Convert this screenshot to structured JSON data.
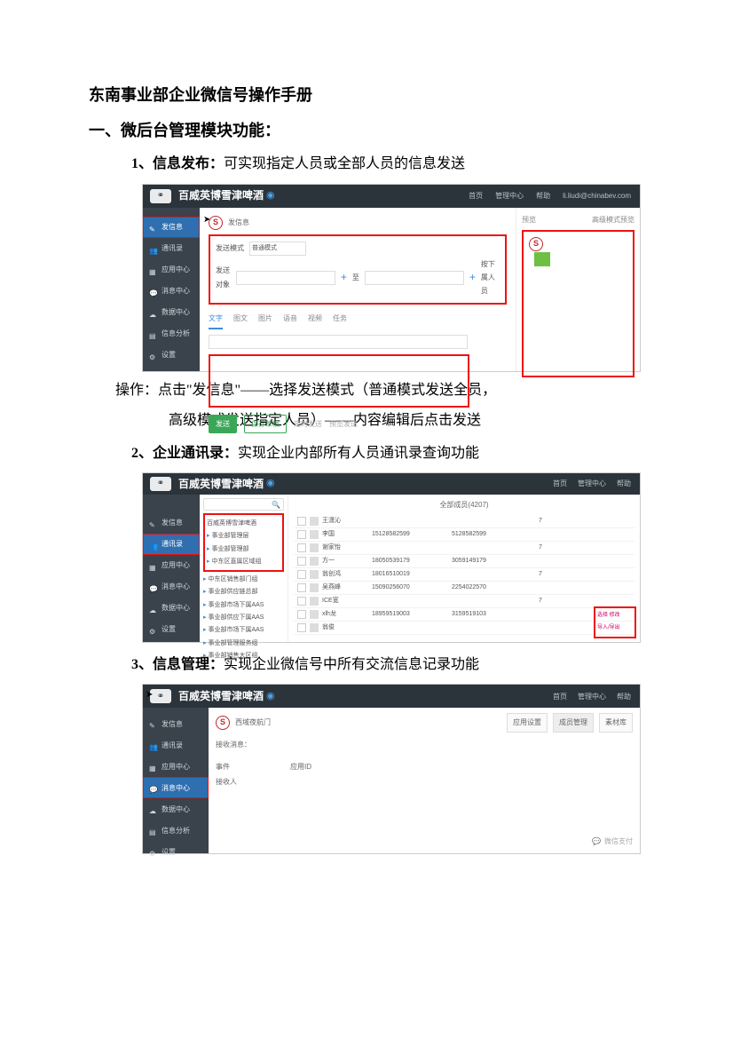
{
  "doc": {
    "title": "东南事业部企业微信号操作手册",
    "section1": "一、微后台管理模块功能：",
    "item1_num": "1、",
    "item1_title": "信息发布：",
    "item1_desc": "可实现指定人员或全部人员的信息发送",
    "op1_l1": "操作：点击\"发信息\"——选择发送模式（普通模式发送全员，",
    "op1_l2": "高级模式发送指定人员）——内容编辑后点击发送",
    "item2_num": "2、",
    "item2_title": "企业通讯录：",
    "item2_desc": "实现企业内部所有人员通讯录查询功能",
    "item3_num": "3、",
    "item3_title": "信息管理：",
    "item3_desc": "实现企业微信号中所有交流信息记录功能"
  },
  "shot1": {
    "brand": "百威英博雪津啤酒",
    "topnav": [
      "首页",
      "管理中心",
      "帮助",
      "li.liudi@chinabev.com"
    ],
    "sidebar": [
      "发信息",
      "通讯录",
      "应用中心",
      "消息中心",
      "数据中心",
      "信息分析",
      "设置"
    ],
    "bar_label": "发信息",
    "mode_row_label": "发送模式",
    "mode_opt": "普通模式",
    "target_label": "发送对象",
    "target_to": "至",
    "target_extra": "按下属人员",
    "tabs": [
      "文字",
      "图文",
      "图片",
      "语音",
      "视频",
      "任务"
    ],
    "btn_send": "发送",
    "btn_save": "保存草稿",
    "foot1": "定时发送",
    "foot2": "预览发送",
    "right_tab1": "预览",
    "right_tab2": "高级模式预览"
  },
  "shot2": {
    "brand": "百威英博雪津啤酒",
    "sidebar": [
      "发信息",
      "通讯录",
      "应用中心",
      "消息中心",
      "数据中心",
      "设置"
    ],
    "tree_top": "百威英博雪津啤酒",
    "tree_items": [
      "事业部管理层",
      "事业部管理部",
      "中东区直属区域组",
      "中东区销售部门组",
      "事业部供应链总部",
      "事业部市场下属AAS",
      "事业部供应下属AAS",
      "事业部市场下属AAS",
      "事业部管理服务组",
      "事业部销售大区组"
    ],
    "table_head": "全部成员(4207)",
    "rows": [
      {
        "name": "王潇沁",
        "p1": "",
        "p2": "",
        "st": "7"
      },
      {
        "name": "李国",
        "p1": "15128582599",
        "p2": "5128582599",
        "st": ""
      },
      {
        "name": "谢家怡",
        "p1": "",
        "p2": "",
        "st": "7"
      },
      {
        "name": "方一",
        "p1": "18050539179",
        "p2": "3059149179",
        "st": ""
      },
      {
        "name": "翁创鸿",
        "p1": "18016510019",
        "p2": "",
        "st": "7"
      },
      {
        "name": "吴燕峰",
        "p1": "15090256070",
        "p2": "2254022570",
        "st": ""
      },
      {
        "name": "ICE宽",
        "p1": "",
        "p2": "",
        "st": "7"
      },
      {
        "name": "xlh龙",
        "p1": "18959519003",
        "p2": "3159519103",
        "st": ""
      },
      {
        "name": "翁俊",
        "p1": "",
        "p2": "",
        "st": ""
      }
    ],
    "side_l1": "选择 修改",
    "side_l2": "导入/导出"
  },
  "shot3": {
    "brand": "百威英博雪津啤酒",
    "sidebar": [
      "发信息",
      "通讯录",
      "应用中心",
      "消息中心",
      "数据中心",
      "信息分析",
      "设置"
    ],
    "slogo_txt": "西域夜航门",
    "btns": [
      "应用设置",
      "成员管理",
      "素材库"
    ],
    "label_receive": "接收消息：",
    "col1": [
      "事件",
      "接收人"
    ],
    "col2": [
      "应用ID"
    ],
    "bb": "微信支付"
  }
}
